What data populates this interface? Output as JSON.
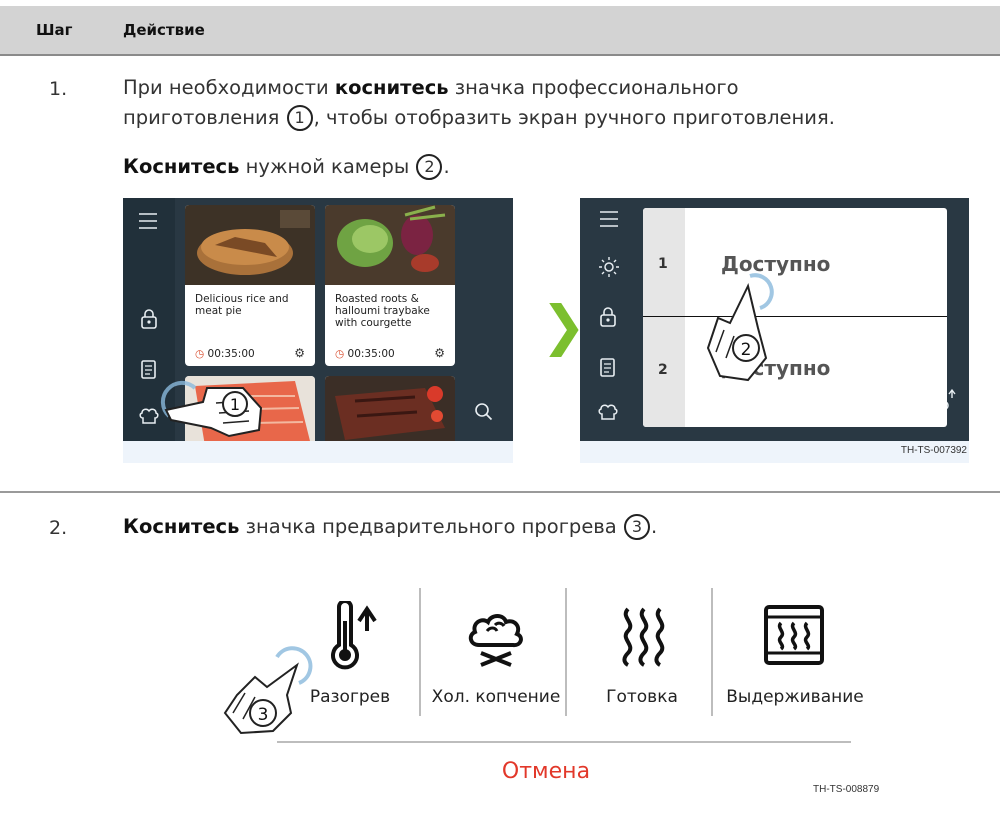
{
  "table": {
    "col_step": "Шаг",
    "col_action": "Действие"
  },
  "step1": {
    "number": "1.",
    "line1_a": "При необходимости ",
    "line1_b": "коснитесь",
    "line1_c": " значка профессионального",
    "line2_a": "приготовления ",
    "line2_circle": "1",
    "line2_b": ", чтобы отобразить экран ручного приготовления.",
    "line3_a": "Коснитесь",
    "line3_b": " нужной камеры ",
    "line3_circle": "2",
    "line3_c": "."
  },
  "figure1": {
    "cards": [
      {
        "title": "Delicious rice and meat pie",
        "time": "00:35:00"
      },
      {
        "title": "Roasted roots & halloumi traybake with courgette",
        "time": "00:35:00"
      }
    ],
    "callout1": "1",
    "chambers": [
      {
        "number": "1",
        "status": "Доступно"
      },
      {
        "number": "2",
        "status": "Доступно"
      }
    ],
    "callout2": "2",
    "code": "TH-TS-007392",
    "icons": [
      "menu-icon",
      "lock-icon",
      "recipe-book-icon",
      "chef-hat-icon",
      "search-icon",
      "sun-icon",
      "thermometer-icon"
    ],
    "accent_green": "#7cbf2e",
    "ui_dark": "#293843"
  },
  "step2": {
    "number": "2.",
    "text_a": "Коснитесь",
    "text_b": " значка предварительного прогрева ",
    "text_circle": "3",
    "text_c": "."
  },
  "figure2": {
    "options": [
      {
        "label": "Разогрев",
        "icon": "preheat-thermometer-icon"
      },
      {
        "label": "Хол. копчение",
        "icon": "cold-smoke-icon"
      },
      {
        "label": "Готовка",
        "icon": "heat-waves-icon"
      },
      {
        "label": "Выдерживание",
        "icon": "hold-warm-icon"
      }
    ],
    "callout3": "3",
    "cancel": "Отмена",
    "code": "TH-TS-008879",
    "cancel_color": "#e2382a"
  }
}
